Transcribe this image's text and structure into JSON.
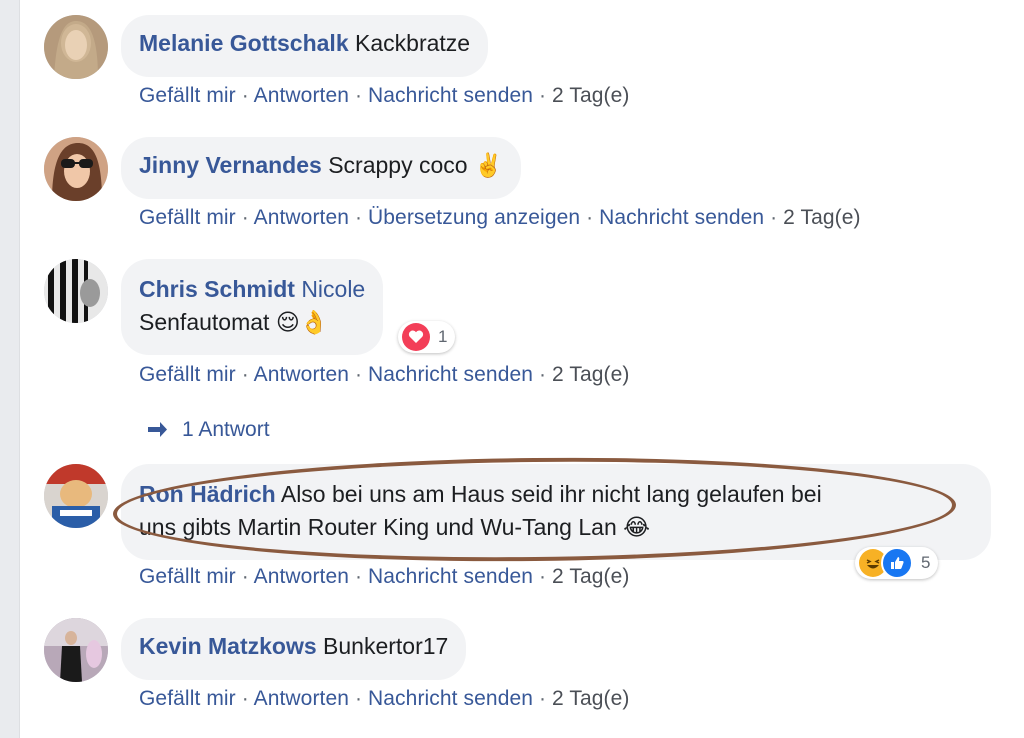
{
  "comments": [
    {
      "author": "Melanie Gottschalk",
      "text": "Kackbratze",
      "actions": [
        "Gefällt mir",
        "Antworten",
        "Nachricht senden"
      ],
      "time": "2 Tag(e)"
    },
    {
      "author": "Jinny Vernandes",
      "text": "Scrappy coco",
      "emoji": "✌️",
      "actions": [
        "Gefällt mir",
        "Antworten",
        "Übersetzung anzeigen",
        "Nachricht senden"
      ],
      "time": "2 Tag(e)"
    },
    {
      "author": "Chris Schmidt",
      "tagged": "Nicole",
      "text": "Senfautomat",
      "emoji": "😌👌",
      "reaction_count": "1",
      "reaction_icons": [
        "heart-icon"
      ],
      "actions": [
        "Gefällt mir",
        "Antworten",
        "Nachricht senden"
      ],
      "time": "2 Tag(e)"
    },
    {
      "author": "Ron Hädrich",
      "text_line1": "Also bei uns am Haus seid ihr nicht lang gelaufen bei",
      "text_line2": "uns gibts Martin Router King und Wu-Tang Lan",
      "emoji": "😂",
      "reaction_count": "5",
      "reaction_icons": [
        "laugh-icon",
        "like-icon"
      ],
      "actions": [
        "Gefällt mir",
        "Antworten",
        "Nachricht senden"
      ],
      "time": "2 Tag(e)"
    },
    {
      "author": "Kevin Matzkows",
      "text": "Bunkertor17",
      "actions": [
        "Gefällt mir",
        "Antworten",
        "Nachricht senden"
      ],
      "time": "2 Tag(e)"
    }
  ],
  "replies_link": "1 Antwort",
  "separator": "·",
  "colors": {
    "link": "#385898",
    "bubble": "#f2f3f5",
    "annotation": "#8a5a3f"
  }
}
